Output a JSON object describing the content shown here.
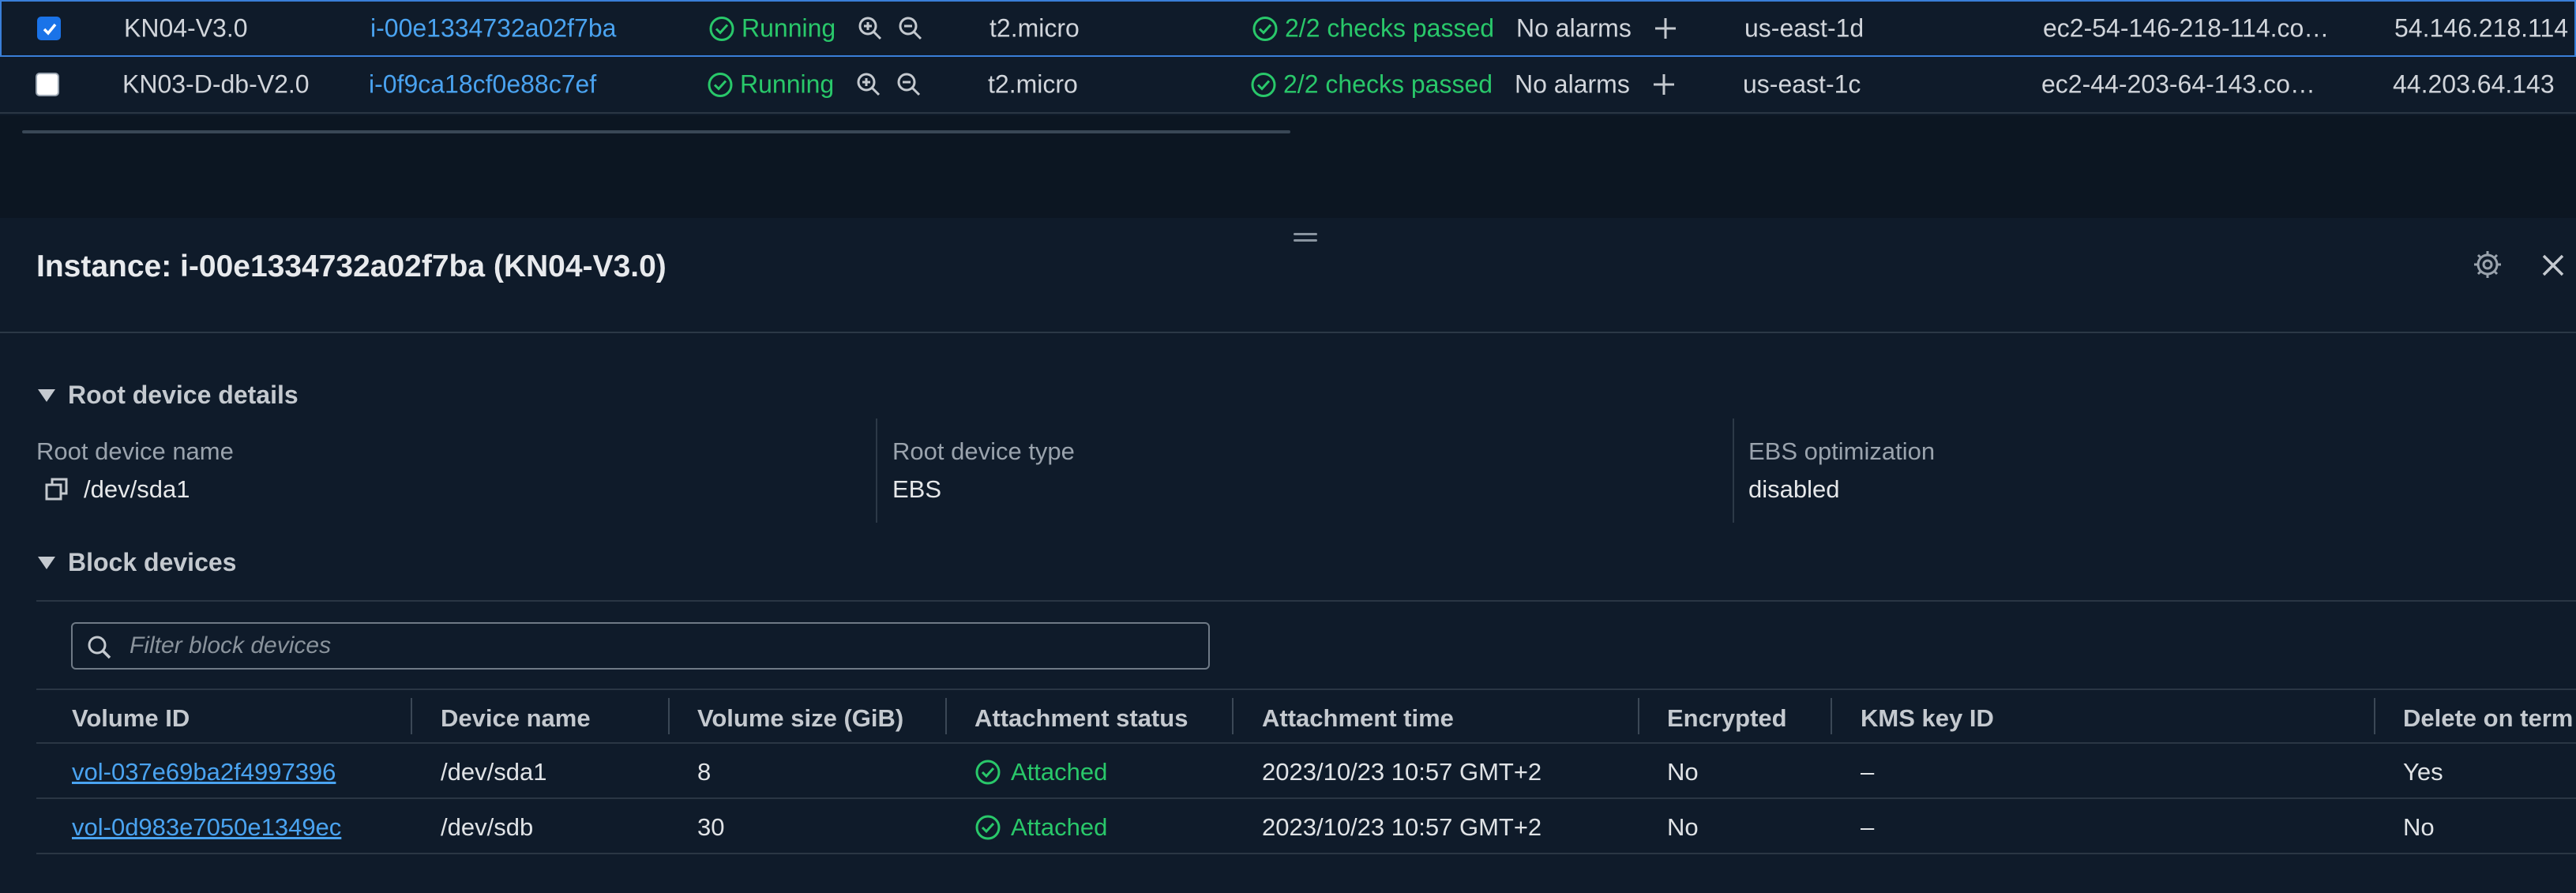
{
  "instances": [
    {
      "selected": true,
      "name": "KN04-V3.0",
      "id": "i-00e1334732a02f7ba",
      "state": "Running",
      "type": "t2.micro",
      "checks": "2/2 checks passed",
      "alarms": "No alarms",
      "az": "us-east-1d",
      "dns": "ec2-54-146-218-114.co…",
      "ip": "54.146.218.114"
    },
    {
      "selected": false,
      "name": "KN03-D-db-V2.0",
      "id": "i-0f9ca18cf0e88c7ef",
      "state": "Running",
      "type": "t2.micro",
      "checks": "2/2 checks passed",
      "alarms": "No alarms",
      "az": "us-east-1c",
      "dns": "ec2-44-203-64-143.co…",
      "ip": "44.203.64.143"
    }
  ],
  "panel": {
    "title": "Instance: i-00e1334732a02f7ba (KN04-V3.0)",
    "root_section": "Root device details",
    "root_device_name_label": "Root device name",
    "root_device_name_value": "/dev/sda1",
    "root_device_type_label": "Root device type",
    "root_device_type_value": "EBS",
    "ebs_opt_label": "EBS optimization",
    "ebs_opt_value": "disabled",
    "block_section": "Block devices",
    "filter_placeholder": "Filter block devices"
  },
  "block_devices": {
    "columns": [
      "Volume ID",
      "Device name",
      "Volume size (GiB)",
      "Attachment status",
      "Attachment time",
      "Encrypted",
      "KMS key ID",
      "Delete on term"
    ],
    "rows": [
      {
        "volume_id": "vol-037e69ba2f4997396",
        "device": "/dev/sda1",
        "size": "8",
        "status": "Attached",
        "time": "2023/10/23 10:57 GMT+2",
        "encrypted": "No",
        "kms": "–",
        "delete": "Yes"
      },
      {
        "volume_id": "vol-0d983e7050e1349ec",
        "device": "/dev/sdb",
        "size": "30",
        "status": "Attached",
        "time": "2023/10/23 10:57 GMT+2",
        "encrypted": "No",
        "kms": "–",
        "delete": "No"
      }
    ]
  },
  "colors": {
    "accent": "#1a73e8",
    "link": "#4aa3f0",
    "success": "#29c86a"
  }
}
